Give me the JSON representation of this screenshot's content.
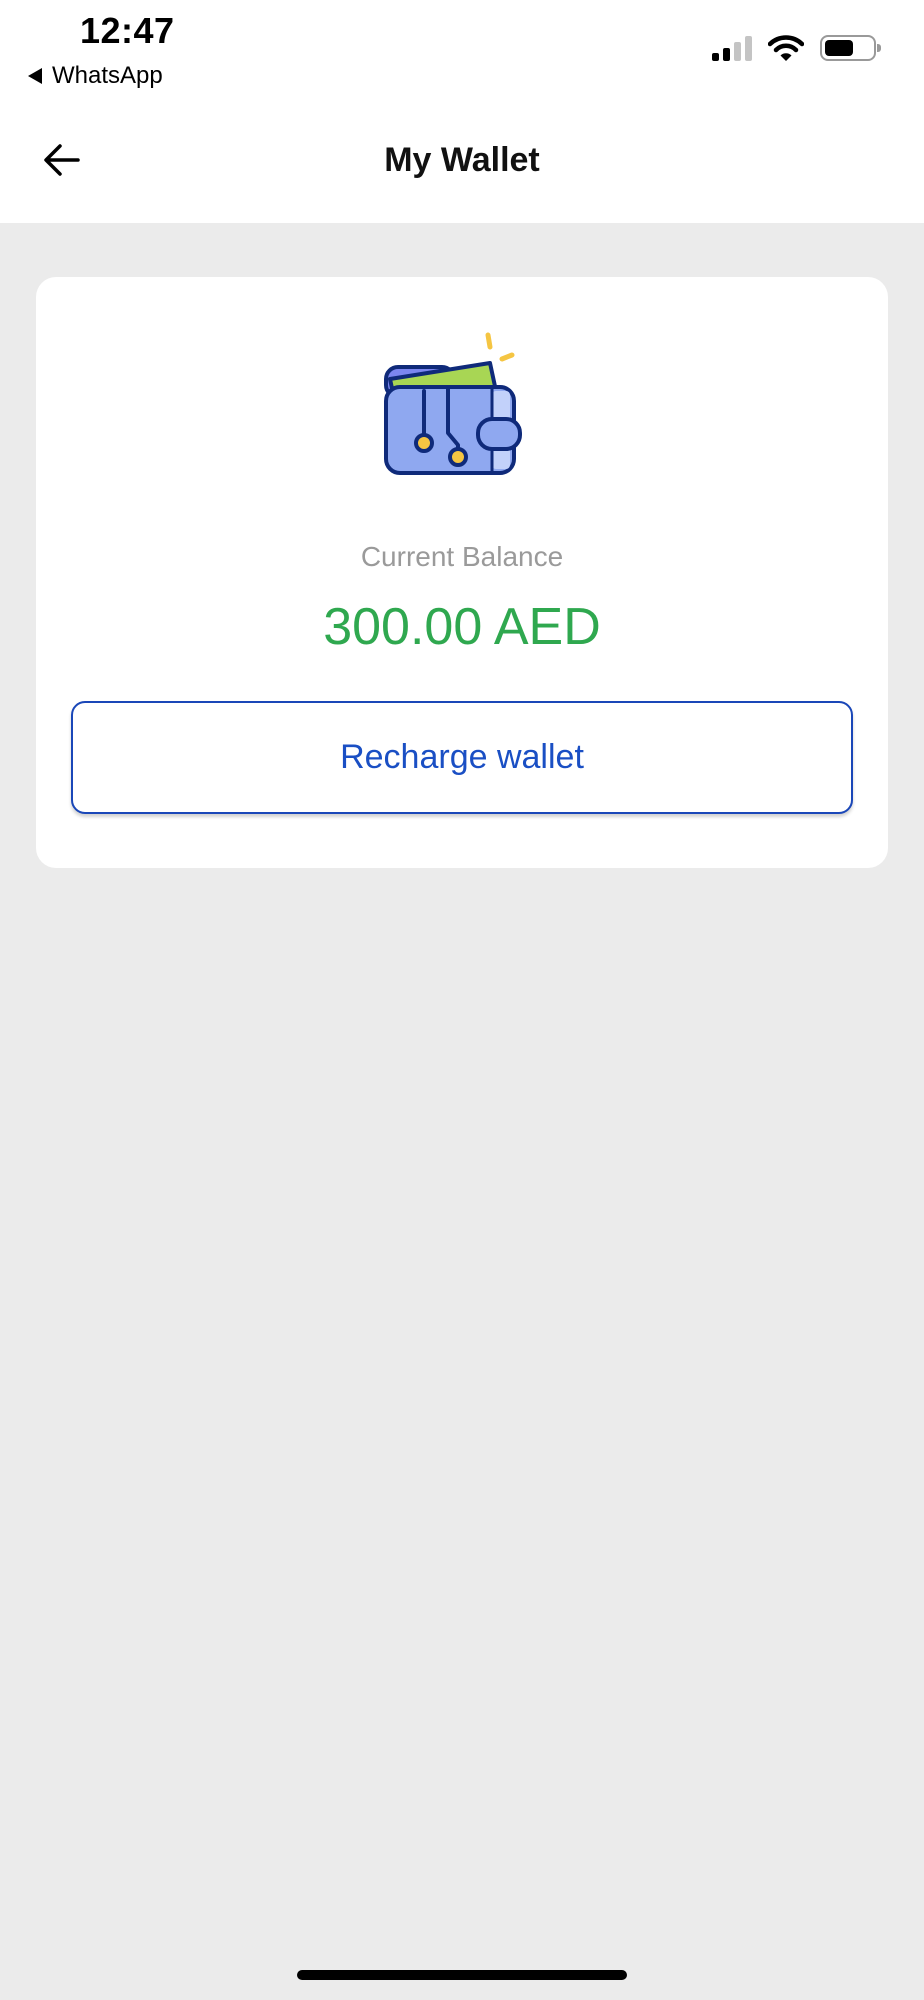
{
  "status_bar": {
    "time": "12:47",
    "back_app": "WhatsApp"
  },
  "header": {
    "title": "My Wallet"
  },
  "wallet": {
    "balance_label": "Current Balance",
    "balance_amount": "300.00 AED",
    "recharge_label": "Recharge wallet"
  },
  "colors": {
    "background": "#ebebeb",
    "balance_green": "#2fa84f",
    "button_blue": "#1a4fc4",
    "wallet_body": "#8fa8f0",
    "wallet_card": "#a8d654",
    "wallet_outline": "#0f2a7a",
    "accent_yellow": "#f5c542"
  },
  "icons": {
    "back": "arrow-left-icon",
    "wallet": "wallet-icon",
    "signal": "signal-icon",
    "wifi": "wifi-icon",
    "battery": "battery-icon"
  }
}
